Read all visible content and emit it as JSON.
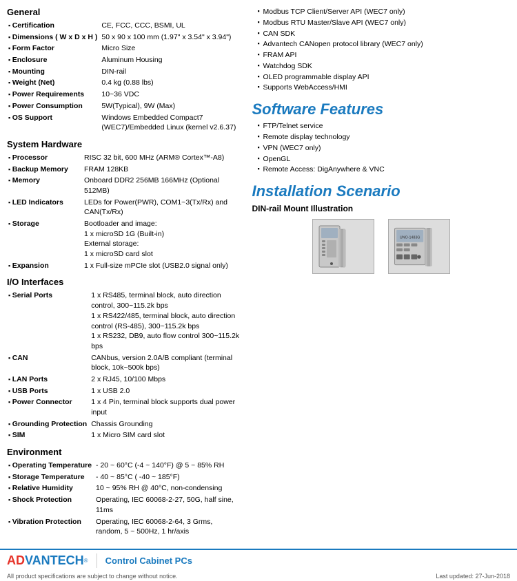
{
  "sections": {
    "general": {
      "title": "General",
      "items": [
        {
          "label": "Certification",
          "value": "CE, FCC, CCC, BSMI, UL"
        },
        {
          "label": "Dimensions ( W x D x H )",
          "value": "50 x 90 x 100 mm (1.97\" x 3.54\" x 3.94\")"
        },
        {
          "label": "Form Factor",
          "value": "Micro Size"
        },
        {
          "label": "Enclosure",
          "value": "Aluminum Housing"
        },
        {
          "label": "Mounting",
          "value": "DIN-rail"
        },
        {
          "label": "Weight (Net)",
          "value": "0.4 kg (0.88 lbs)"
        },
        {
          "label": "Power Requirements",
          "value": "10~36 VDC"
        },
        {
          "label": "Power Consumption",
          "value": "5W(Typical), 9W (Max)"
        },
        {
          "label": "OS Support",
          "value": "Windows Embedded Compact7 (WEC7)/Embedded Linux (kernel v2.6.37)"
        }
      ]
    },
    "system_hardware": {
      "title": "System Hardware",
      "items": [
        {
          "label": "Processor",
          "value": "RISC 32 bit, 600 MHz (ARM® Cortex™-A8)"
        },
        {
          "label": "Backup Memory",
          "value": "FRAM 128KB"
        },
        {
          "label": "Memory",
          "value": "Onboard DDR2 256MB 166MHz (Optional 512MB)"
        },
        {
          "label": "LED Indicators",
          "value": "LEDs for Power(PWR), COM1~3(Tx/Rx) and CAN(Tx/Rx)"
        },
        {
          "label": "Storage",
          "value": "Bootloader and image:\n1 x microSD 1G (Built-in)\nExternal storage:\n1 x microSD card slot"
        },
        {
          "label": "Expansion",
          "value": "1 x Full-size mPCIe slot (USB2.0 signal only)"
        }
      ]
    },
    "io_interfaces": {
      "title": "I/O Interfaces",
      "items": [
        {
          "label": "Serial Ports",
          "value": "1 x RS485, terminal block, auto direction control, 300~115.2k bps\n1 x RS422/485, terminal block, auto direction control (RS-485), 300~115.2k bps\n1 x RS232, DB9, auto flow control 300~115.2k bps"
        },
        {
          "label": "CAN",
          "value": "CANbus, version 2.0A/B compliant (terminal block, 10k~500k bps)"
        },
        {
          "label": "LAN Ports",
          "value": "2 x RJ45, 10/100 Mbps"
        },
        {
          "label": "USB Ports",
          "value": "1 x USB 2.0"
        },
        {
          "label": "Power Connector",
          "value": "1 x 4 Pin, terminal block supports dual power input"
        },
        {
          "label": "Grounding Protection",
          "value": "Chassis Grounding"
        },
        {
          "label": "SIM",
          "value": "1 x Micro SIM card slot"
        }
      ]
    },
    "environment": {
      "title": "Environment",
      "items": [
        {
          "label": "Operating Temperature",
          "value": "- 20 ~ 60°C (-4 ~ 140°F) @ 5 ~ 85% RH"
        },
        {
          "label": "Storage Temperature",
          "value": "- 40 ~ 85°C ( -40 ~ 185°F)"
        },
        {
          "label": "Relative Humidity",
          "value": "10 ~ 95% RH @ 40°C, non-condensing"
        },
        {
          "label": "Shock Protection",
          "value": "Operating, IEC 60068-2-27, 50G, half sine, 11ms"
        },
        {
          "label": "Vibration Protection",
          "value": "Operating, IEC 60068-2-64, 3 Grms, random, 5 ~ 500Hz, 1 hr/axis"
        }
      ]
    }
  },
  "right_col": {
    "bullet_items": [
      "Modbus TCP Client/Server API (WEC7 only)",
      "Modbus RTU Master/Slave API (WEC7 only)",
      "CAN SDK",
      "Advantech CANopen protocol library (WEC7 only)",
      "FRAM API",
      "Watchdog SDK",
      "OLED programmable display API",
      "Supports WebAccess/HMI"
    ],
    "software_title": "Software Features",
    "software_items": [
      "FTP/Telnet service",
      "Remote display technology",
      "VPN (WEC7 only)",
      "OpenGL",
      "Remote Access: DigAnywhere & VNC"
    ],
    "install_title": "Installation Scenario",
    "install_sub": "DIN-rail Mount Illustration"
  },
  "footer": {
    "logo_ad": "AD",
    "logo_vantech": "VANTECH",
    "trademark": "®",
    "category": "Control Cabinet PCs",
    "note": "All product specifications are subject to change without notice.",
    "updated": "Last updated: 27-Jun-2018"
  }
}
